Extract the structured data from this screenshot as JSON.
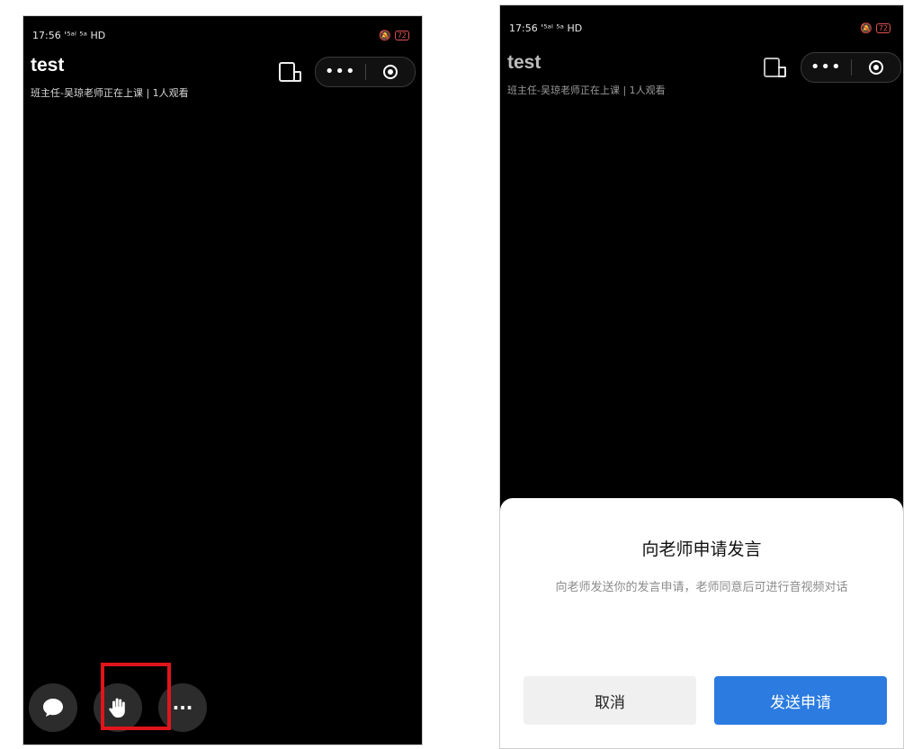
{
  "status_bar": {
    "time_signal": "17:56 '⁵ᵃˡ ⁵ᵃ HD",
    "battery": "72"
  },
  "left_screen": {
    "title": "test",
    "subtitle": "班主任-吴琼老师正在上课 | 1人观看",
    "capsule_more": "•••",
    "actions": {
      "more_label": "···"
    }
  },
  "right_screen": {
    "title": "test",
    "subtitle": "班主任-吴琼老师正在上课 | 1人观看",
    "capsule_more": "•••",
    "dialog": {
      "title": "向老师申请发言",
      "description": "向老师发送你的发言申请，老师同意后可进行音视频对话",
      "cancel_label": "取消",
      "send_label": "发送申请"
    }
  },
  "colors": {
    "highlight": "#e0151b",
    "primary": "#2b7be0",
    "cancel_bg": "#f0f0f0"
  }
}
